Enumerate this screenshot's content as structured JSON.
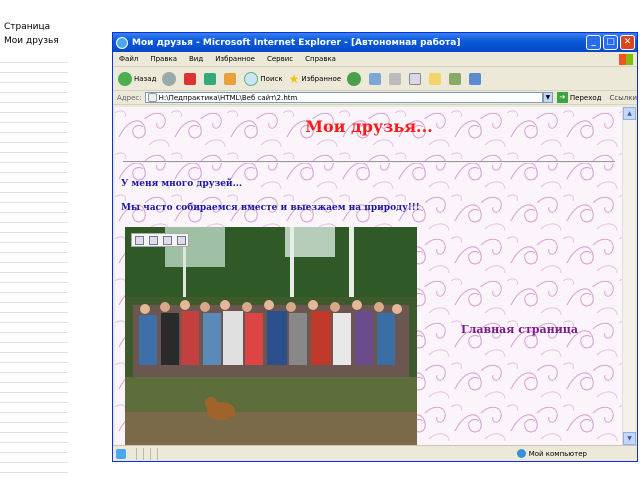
{
  "outline": {
    "item1": "Страница",
    "item2": "Мои друзья"
  },
  "window": {
    "title": "Мои друзья - Microsoft Internet Explorer - [Автономная работа]",
    "buttons": {
      "minimize": "_",
      "maximize": "□",
      "close": "✕"
    }
  },
  "menu": [
    "Файл",
    "Правка",
    "Вид",
    "Избранное",
    "Сервис",
    "Справка"
  ],
  "toolbar": {
    "back": "Назад",
    "search": "Поиск",
    "favorites": "Избранное"
  },
  "address": {
    "label": "Адрес:",
    "value": "H:\\Педпрактика\\HTML\\Веб сайт\\2.htm",
    "go": "Переход",
    "links": "Ссылки"
  },
  "page": {
    "heading": "Мои друзья...",
    "line1": "У меня много друзей...",
    "line2": "Мы часто собираемся вместе и выезжаем на природу!!!",
    "home_link": "Главная страница"
  },
  "status": {
    "zone": "Мой компьютер"
  }
}
